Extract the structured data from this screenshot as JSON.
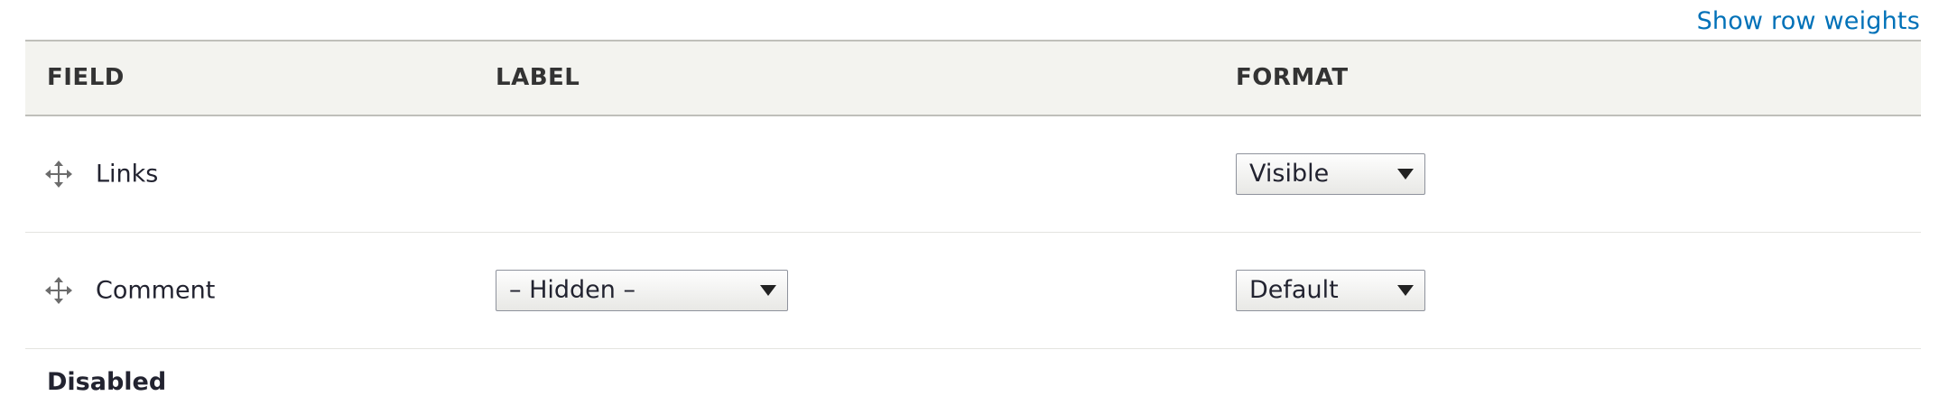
{
  "actions": {
    "show_row_weights": "Show row weights"
  },
  "table": {
    "headers": {
      "field": "Field",
      "label": "Label",
      "format": "Format"
    },
    "rows": [
      {
        "field": "Links",
        "label_select": null,
        "format_select": "Visible"
      },
      {
        "field": "Comment",
        "label_select": "– Hidden –",
        "format_select": "Default"
      }
    ]
  },
  "regions": {
    "disabled_title": "Disabled"
  },
  "colors": {
    "link": "#0071b8",
    "header_bg": "#f3f3ef",
    "text": "#222330"
  },
  "icons": {
    "drag": "drag-handle-icon",
    "select_caret": "caret-down-icon"
  }
}
